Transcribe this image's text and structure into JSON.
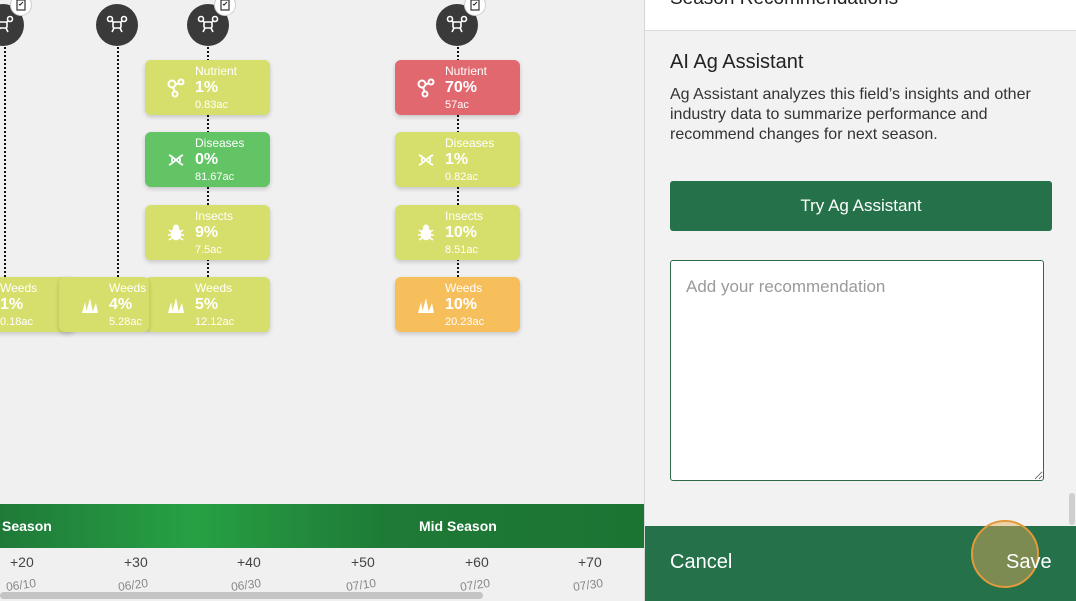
{
  "timeline": {
    "cards": [
      {
        "id": "c1",
        "label": "Nutrient",
        "pct": "1%",
        "ac": "0.83ac",
        "icon": "nutrient-icon",
        "color": "yellow"
      },
      {
        "id": "c2",
        "label": "Diseases",
        "pct": "0%",
        "ac": "81.67ac",
        "icon": "dna-icon",
        "color": "green"
      },
      {
        "id": "c3",
        "label": "Insects",
        "pct": "9%",
        "ac": "7.5ac",
        "icon": "bug-icon",
        "color": "yellow"
      },
      {
        "id": "c4",
        "label": "Weeds",
        "pct": "5%",
        "ac": "12.12ac",
        "icon": "weed-icon",
        "color": "yellow"
      },
      {
        "id": "c5",
        "label": "Nutrient",
        "pct": "70%",
        "ac": "57ac",
        "icon": "nutrient-icon",
        "color": "red"
      },
      {
        "id": "c6",
        "label": "Diseases",
        "pct": "1%",
        "ac": "0.82ac",
        "icon": "dna-icon",
        "color": "yellow"
      },
      {
        "id": "c7",
        "label": "Insects",
        "pct": "10%",
        "ac": "8.51ac",
        "icon": "bug-icon",
        "color": "yellow"
      },
      {
        "id": "c8",
        "label": "Weeds",
        "pct": "10%",
        "ac": "20.23ac",
        "icon": "weed-icon",
        "color": "orange"
      },
      {
        "id": "c9",
        "label": "Weeds",
        "pct": "1%",
        "ac": "0.18ac",
        "icon": "weed-icon",
        "color": "yellow"
      },
      {
        "id": "c10",
        "label": "Weeds",
        "pct": "4%",
        "ac": "5.28ac",
        "icon": "weed-icon",
        "color": "yellow"
      }
    ],
    "season_labels": [
      "Season",
      "Mid Season"
    ],
    "ticks": [
      "+20",
      "+30",
      "+40",
      "+50",
      "+60",
      "+70"
    ],
    "dates": [
      "06/10",
      "06/20",
      "06/30",
      "07/10",
      "07/20",
      "07/30"
    ]
  },
  "panel": {
    "header_title": "Season Recommendations",
    "ai_title": "AI Ag Assistant",
    "ai_description": "Ag Assistant analyzes this field’s insights and other industry data to summarize performance and recommend changes for next season.",
    "try_button": "Try Ag Assistant",
    "recommendation_placeholder": "Add your recommendation",
    "cancel_label": "Cancel",
    "save_label": "Save"
  },
  "colors": {
    "yellow": "#d6df6b",
    "green": "#63c466",
    "red": "#e0686e",
    "orange": "#f7bf5c",
    "brand_green": "#24714a",
    "click_highlight": "#e39a3b"
  }
}
